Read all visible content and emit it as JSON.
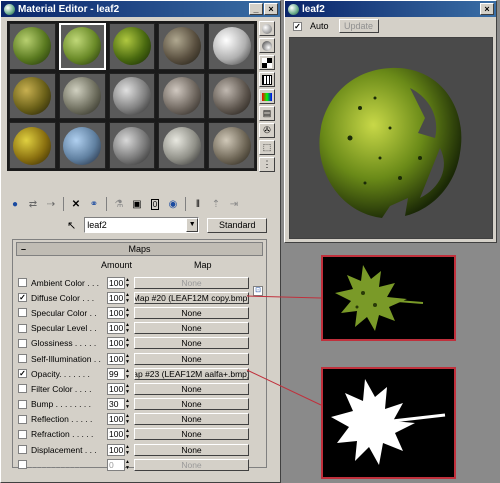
{
  "material_editor": {
    "title": "Material Editor - leaf2",
    "name_value": "leaf2",
    "type_button": "Standard",
    "maps_rollout_title": "Maps",
    "col_amount": "Amount",
    "col_map": "Map",
    "rows": [
      {
        "label": "Ambient Color . . .",
        "checked": false,
        "amount": "100",
        "map": "None",
        "disabled_map": true
      },
      {
        "label": "Diffuse Color . . .",
        "checked": true,
        "amount": "100",
        "map": "Map #20 (LEAF12M copy.bmp)"
      },
      {
        "label": "Specular Color . .",
        "checked": false,
        "amount": "100",
        "map": "None"
      },
      {
        "label": "Specular Level . .",
        "checked": false,
        "amount": "100",
        "map": "None"
      },
      {
        "label": "Glossiness . . . . .",
        "checked": false,
        "amount": "100",
        "map": "None"
      },
      {
        "label": "Self-Illumination . .",
        "checked": false,
        "amount": "100",
        "map": "None"
      },
      {
        "label": "Opacity. . . . . . .",
        "checked": true,
        "amount": "99",
        "map": "ap #23 (LEAF12M aalfa+.bmp)"
      },
      {
        "label": "Filter Color . . . .",
        "checked": false,
        "amount": "100",
        "map": "None"
      },
      {
        "label": "Bump . . . . . . . .",
        "checked": false,
        "amount": "30",
        "map": "None"
      },
      {
        "label": "Reflection . . . . .",
        "checked": false,
        "amount": "100",
        "map": "None"
      },
      {
        "label": "Refraction . . . . .",
        "checked": false,
        "amount": "100",
        "map": "None"
      },
      {
        "label": "Displacement . . .",
        "checked": false,
        "amount": "100",
        "map": "None"
      },
      {
        "label": ". . . . . . . . . . .",
        "checked": false,
        "amount": "0",
        "map": "None",
        "disabled": true
      }
    ]
  },
  "preview": {
    "title": "leaf2",
    "auto_label": "Auto",
    "update_label": "Update"
  },
  "icons": [
    "close-icon",
    "checker-icon",
    "sample-sphere-icon",
    "get-material-icon",
    "delete-icon",
    "pick-icon",
    "navigate-up-icon"
  ]
}
